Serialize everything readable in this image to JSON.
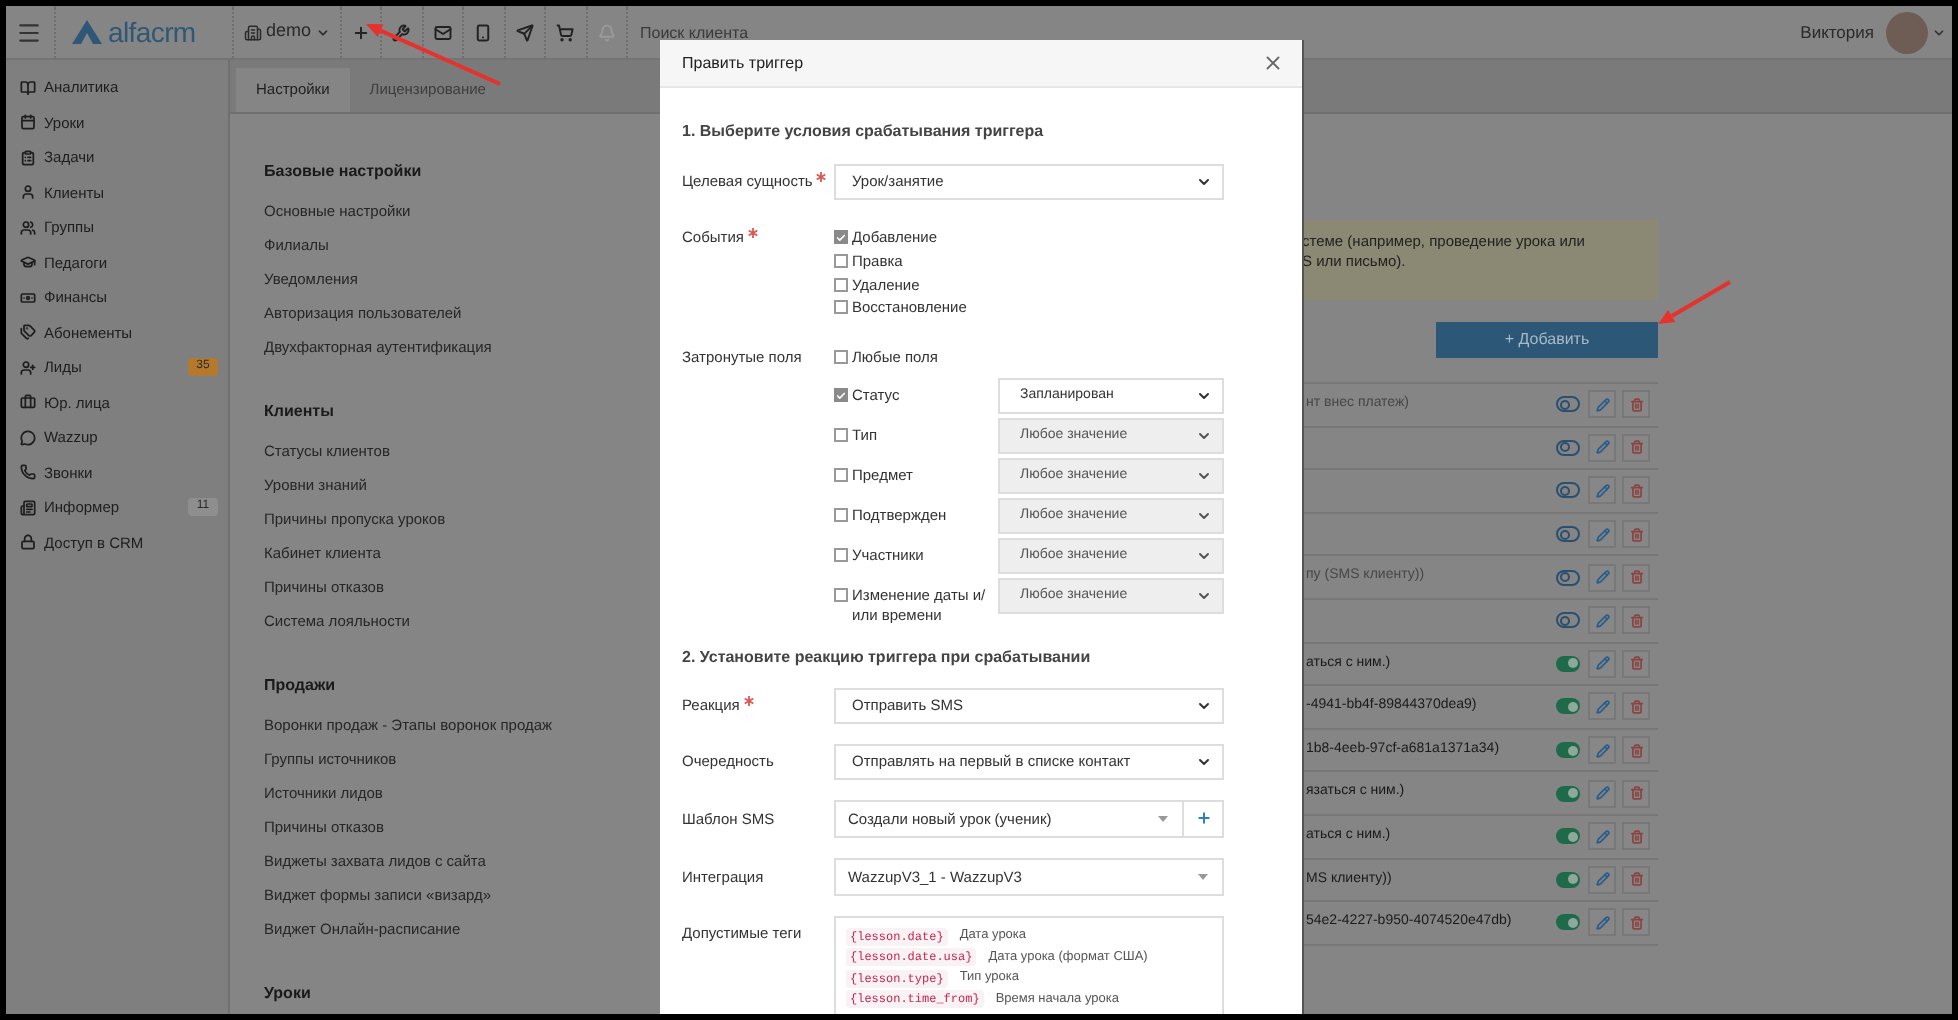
{
  "top_bar": {
    "logo": "alfacrm",
    "project": "demo",
    "search": {
      "placeholder": "Поиск клиента"
    },
    "user": "Виктория"
  },
  "sidebar": {
    "items": [
      {
        "label": "Аналитика"
      },
      {
        "label": "Уроки"
      },
      {
        "label": "Задачи"
      },
      {
        "label": "Клиенты"
      },
      {
        "label": "Группы"
      },
      {
        "label": "Педагоги"
      },
      {
        "label": "Финансы"
      },
      {
        "label": "Абонементы"
      },
      {
        "label": "Лиды",
        "badge": {
          "text": "35",
          "color": "#b5792e"
        }
      },
      {
        "label": "Юр. лица"
      },
      {
        "label": "Wazzup"
      },
      {
        "label": "Звонки"
      },
      {
        "label": "Информер",
        "badge": {
          "text": "11",
          "color": "#8e8e8e"
        }
      },
      {
        "label": "Доступ в CRM"
      }
    ]
  },
  "tabs": [
    {
      "label": "Настройки",
      "selected": true
    },
    {
      "label": "Лицензирование",
      "selected": false
    }
  ],
  "settings_sections": [
    {
      "title": "Базовые настройки",
      "items": [
        "Основные настройки",
        "Филиалы",
        "Уведомления",
        "Авторизация пользователей",
        "Двухфакторная аутентификация"
      ]
    },
    {
      "title": "Клиенты",
      "items": [
        "Статусы клиентов",
        "Уровни знаний",
        "Причины пропуска уроков",
        "Кабинет клиента",
        "Причины отказов",
        "Система лояльности"
      ]
    },
    {
      "title": "Продажи",
      "items": [
        "Воронки продаж - Этапы воронок продаж",
        "Группы источников",
        "Источники лидов",
        "Причины отказов",
        "Виджеты захвата лидов с сайта",
        "Виджет формы записи «визард»",
        "Виджет Онлайн-расписание"
      ]
    },
    {
      "title": "Уроки"
    }
  ],
  "alert": {
    "lines": [
      "стеме (например, проведение урока или",
      "S или письмо)."
    ]
  },
  "add_button": "+ Добавить",
  "triggers": [
    {
      "text": "нт внес платеж)",
      "on": false
    },
    {
      "on": false
    },
    {
      "on": false
    },
    {
      "on": false
    },
    {
      "text": "пу (SMS клиенту))",
      "on": false
    },
    {
      "on": false
    },
    {
      "text": "аться с ним.)",
      "on": true
    },
    {
      "text": "-4941-bb4f-89844370dea9)",
      "on": true
    },
    {
      "text": "1b8-4eeb-97cf-a681a1371a34)",
      "on": true
    },
    {
      "text": "язаться с ним.)",
      "on": true
    },
    {
      "text": "аться с ним.)",
      "on": true
    },
    {
      "text": "MS клиенту))",
      "on": true
    },
    {
      "text": "54e2-4227-b950-4074520e47db)",
      "on": true
    }
  ],
  "modal": {
    "title": "Править триггер",
    "section_1": "1. Выберите условия срабатывания триггера",
    "target": {
      "label": "Целевая сущность",
      "required": true,
      "value": "Урок/занятие"
    },
    "events": {
      "label": "События",
      "required": true,
      "options": [
        {
          "label": "Добавление",
          "checked": true
        },
        {
          "label": "Правка",
          "checked": false
        },
        {
          "label": "Удаление",
          "checked": false
        },
        {
          "label": "Восстановление",
          "checked": false
        }
      ]
    },
    "fields": {
      "label": "Затронутые поля",
      "any": {
        "label": "Любые поля",
        "checked": false
      },
      "rows": [
        {
          "label": "Статус",
          "checked": true,
          "value": "Запланирован"
        },
        {
          "label": "Тип",
          "checked": false,
          "value": "Любое значение"
        },
        {
          "label": "Предмет",
          "checked": false,
          "value": "Любое значение"
        },
        {
          "label": "Подтвержден",
          "checked": false,
          "value": "Любое значение"
        },
        {
          "label": "Участники",
          "checked": false,
          "value": "Любое значение"
        },
        {
          "label": "Изменение даты и/ или времени",
          "checked": false,
          "value": "Любое значение"
        }
      ]
    },
    "section_2": "2. Установите реакцию триггера при срабатывании",
    "reaction": [
      {
        "kind": "select",
        "label": "Реакция",
        "required": true,
        "value": "Отправить SMS"
      },
      {
        "kind": "select",
        "label": "Очередность",
        "required": false,
        "value": "Отправлять на первый в списке контакт"
      },
      {
        "kind": "combo_add",
        "label": "Шаблон SMS",
        "required": false,
        "value": "Создали новый урок (ученик)"
      },
      {
        "kind": "combo",
        "label": "Интеграция",
        "required": false,
        "value": "WazzupV3_1 - WazzupV3"
      }
    ],
    "tags": {
      "label": "Допустимые теги",
      "items": [
        {
          "tag": "{lesson.date}",
          "description": "Дата урока"
        },
        {
          "tag": "{lesson.date.usa}",
          "description": "Дата урока (формат США)"
        },
        {
          "tag": "{lesson.type}",
          "description": "Тип урока"
        },
        {
          "tag": "{lesson.time_from}",
          "description": "Время начала урока"
        }
      ]
    }
  }
}
